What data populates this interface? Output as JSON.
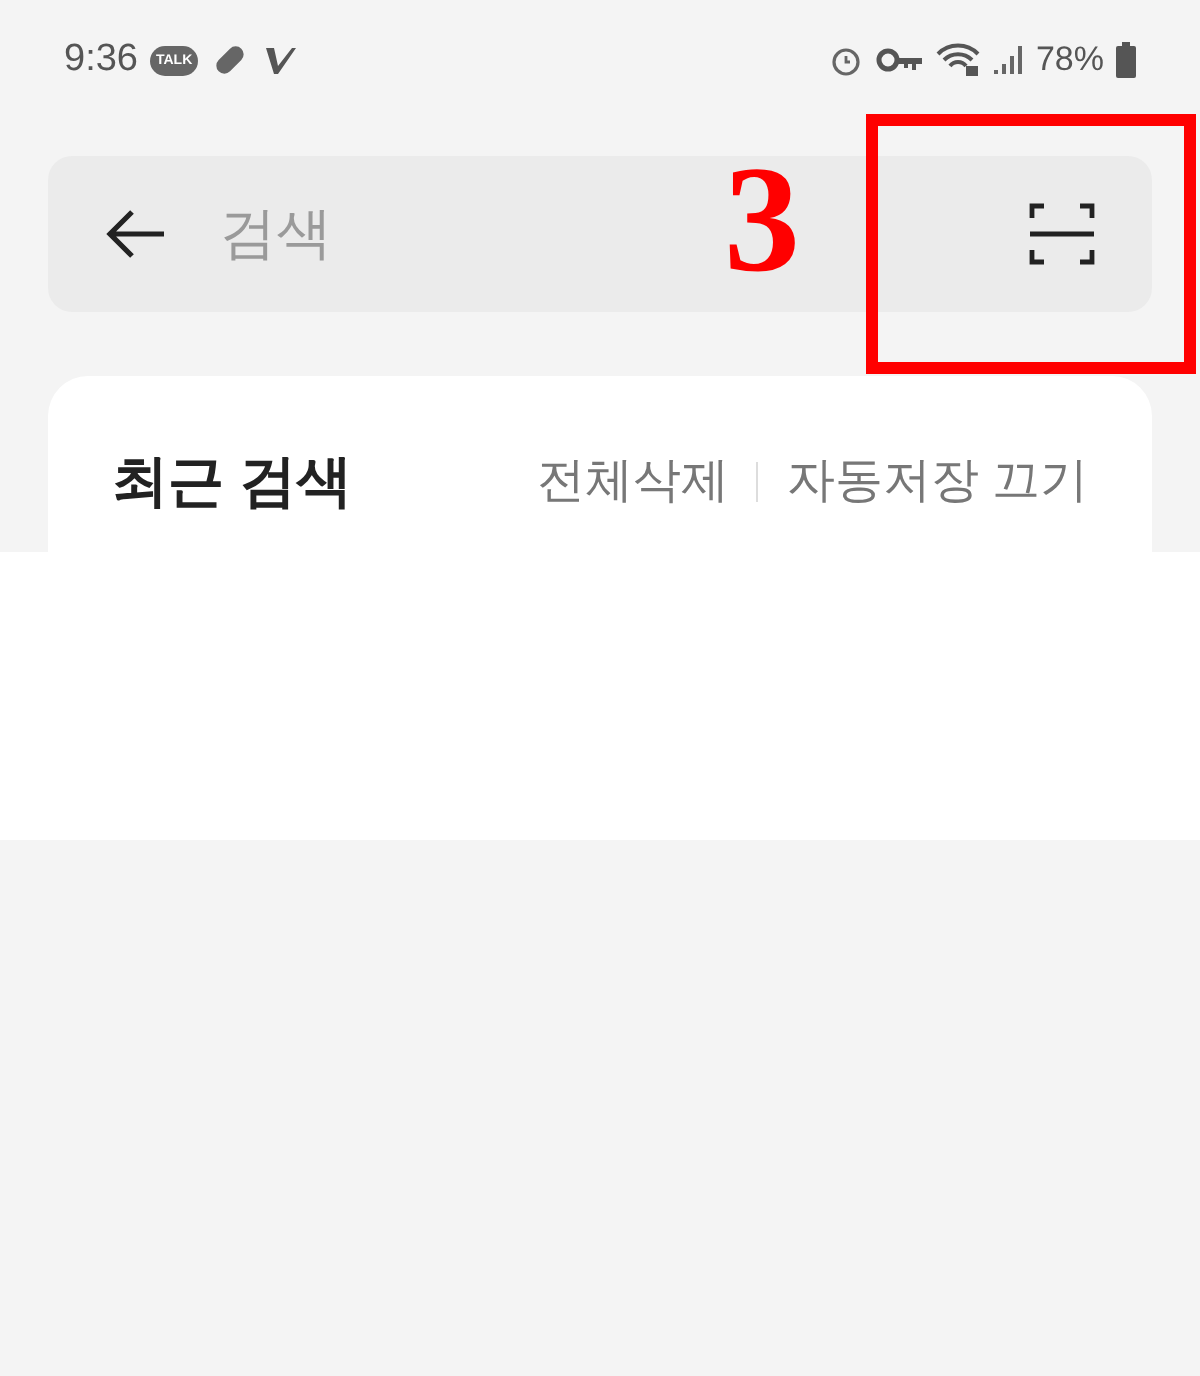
{
  "status_bar": {
    "time": "9:36",
    "talk_badge": "TALK",
    "battery": "78%"
  },
  "search": {
    "placeholder": "검색"
  },
  "recent": {
    "title": "최근 검색",
    "actions": [
      "전체삭제",
      "자동저장 끄기"
    ]
  },
  "annotation": {
    "label": "3"
  }
}
